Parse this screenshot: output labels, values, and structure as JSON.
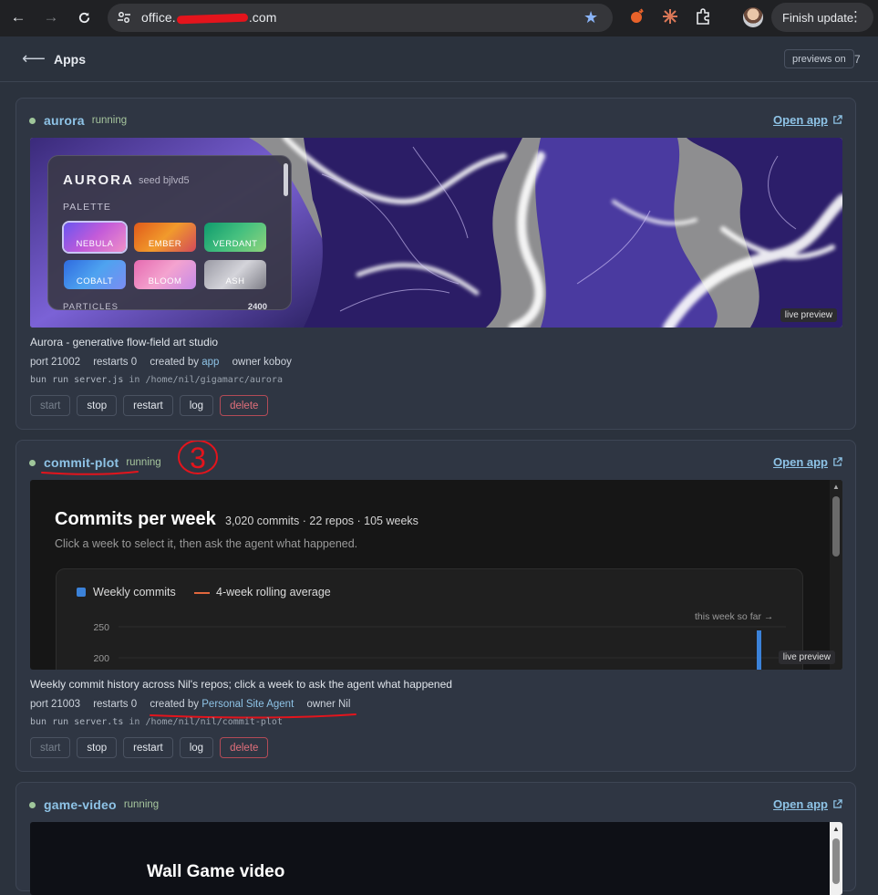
{
  "browser": {
    "url_prefix": "office.",
    "url_suffix": ".com",
    "finish_update": "Finish update"
  },
  "header": {
    "back_icon": "arrow-left-icon",
    "title": "Apps",
    "previews_toggle": "previews on",
    "count": "7"
  },
  "apps": [
    {
      "name": "aurora",
      "status": "running",
      "open_label": "Open app",
      "live_badge": "live preview",
      "description": "Aurora - generative flow-field art studio",
      "port": "port 21002",
      "restarts": "restarts 0",
      "created_by_label": "created by",
      "created_by": "app",
      "owner": "owner koboy",
      "cmd": "bun run server.js",
      "cmd_in": "in /home/nil/gigamarc/aurora",
      "preview": {
        "title": "AURORA",
        "seed": "seed bjlvd5",
        "palette_label": "PALETTE",
        "swatches": [
          "NEBULA",
          "EMBER",
          "VERDANT",
          "COBALT",
          "BLOOM",
          "ASH"
        ],
        "particles_label": "PARTICLES",
        "particles_value": "2400"
      }
    },
    {
      "name": "commit-plot",
      "status": "running",
      "open_label": "Open app",
      "live_badge": "live preview",
      "description": "Weekly commit history across Nil's repos; click a week to ask the agent what happened",
      "port": "port 21003",
      "restarts": "restarts 0",
      "created_by_label": "created by",
      "created_by": "Personal Site Agent",
      "owner": "owner Nil",
      "cmd": "bun run server.ts",
      "cmd_in": "in /home/nil/nil/commit-plot",
      "annotation": "3",
      "preview": {
        "title": "Commits per week",
        "subtitle": "3,020 commits · 22 repos · 105 weeks",
        "help": "Click a week to select it, then ask the agent what happened.",
        "legend_bars": "Weekly commits",
        "legend_line": "4-week rolling average",
        "annotation": "this week so far →"
      }
    },
    {
      "name": "game-video",
      "status": "running",
      "open_label": "Open app",
      "preview": {
        "title": "Wall Game video"
      }
    }
  ],
  "buttons": {
    "start": "start",
    "stop": "stop",
    "restart": "restart",
    "log": "log",
    "delete": "delete"
  },
  "chart_data": {
    "type": "bar",
    "title": "Commits per week",
    "subtitle": "3,020 commits · 22 repos · 105 weeks",
    "series": [
      {
        "name": "Weekly commits"
      },
      {
        "name": "4-week rolling average"
      }
    ],
    "y_ticks": [
      250,
      200
    ],
    "annotation": "this week so far →"
  },
  "colors": {
    "accent": "#8ec3e6",
    "running": "#a6c59d",
    "danger": "#e06f7a",
    "bar": "#3b82d9",
    "rolling": "#e0673d",
    "annotation_red": "#e4141c"
  }
}
